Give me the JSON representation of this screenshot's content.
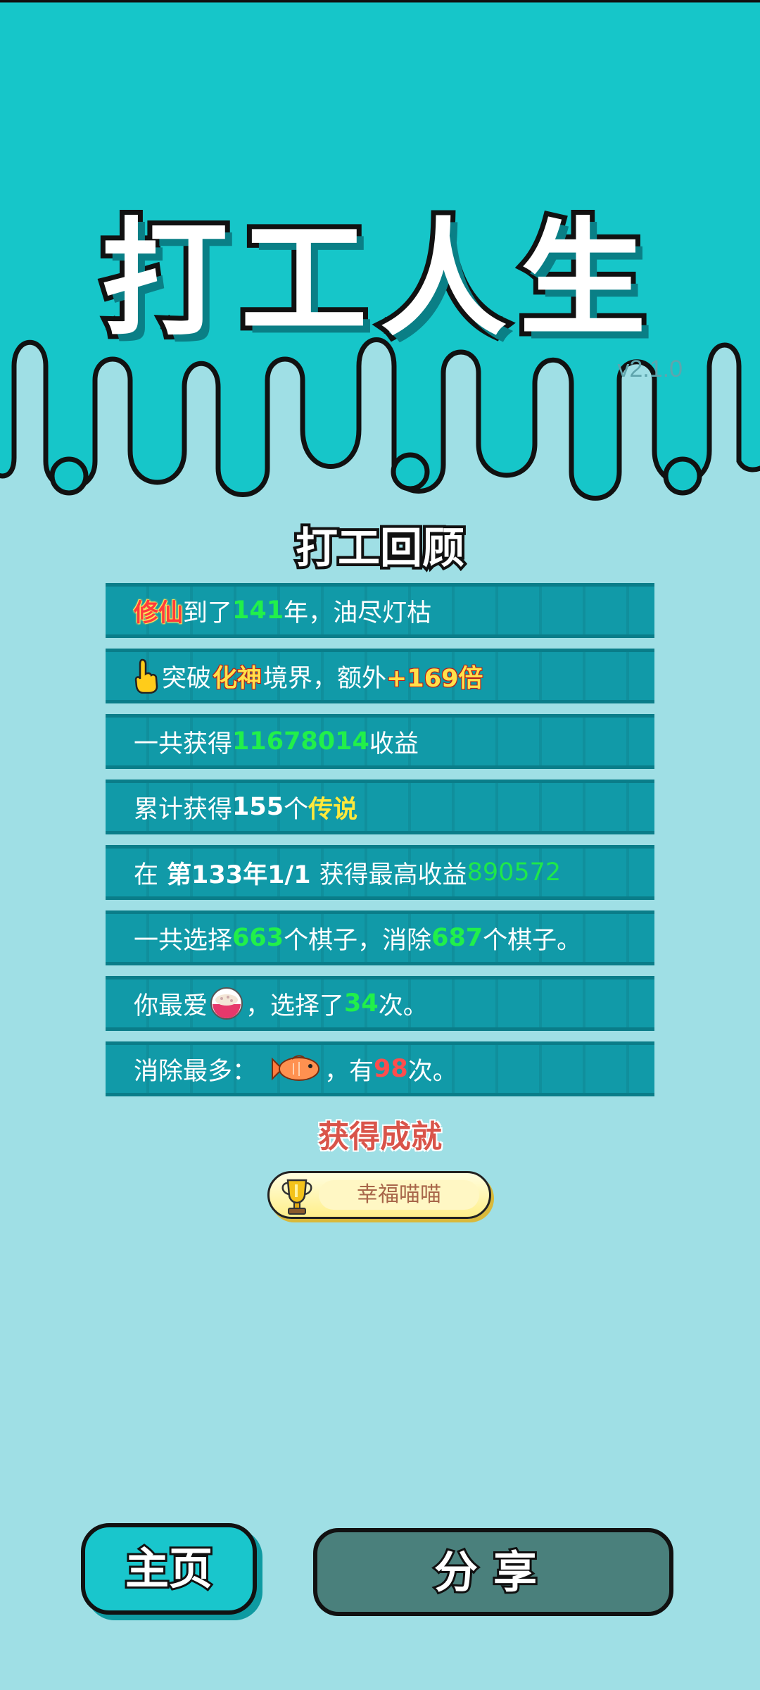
{
  "app": {
    "title": "打工人生",
    "version": "v2.1.0"
  },
  "colors": {
    "top_band": "#16c6c9",
    "body": "#9fdfe5",
    "row": "#119aa8",
    "green": "#21f04a",
    "share_button": "#4a807c"
  },
  "review": {
    "title": "打工回顾",
    "r1": {
      "a": "修仙",
      "b": "到了",
      "c": "141",
      "d": "年，油尽灯枯"
    },
    "r2": {
      "icon": "pointing-hand-icon",
      "a": "突破",
      "b": "化神",
      "c": "境界，额外",
      "d": "+169倍"
    },
    "r3": {
      "a": "一共获得",
      "b": "11678014",
      "c": "收益"
    },
    "r4": {
      "a": "累计获得",
      "b": "155",
      "c": "个",
      "d": "传说"
    },
    "r5": {
      "a": "在 ",
      "b": "第133年1/1",
      "c": " 获得最高收益",
      "d": "890572"
    },
    "r6": {
      "a": "一共选择",
      "b": "663",
      "c": "个棋子，消除",
      "d": "687",
      "e": "个棋子。"
    },
    "r7": {
      "a": "你最爱",
      "icon": "rice-bowl-icon",
      "b": "，选择了",
      "c": "34",
      "d": "次。"
    },
    "r8": {
      "a": "消除最多：",
      "icon": "fish-icon",
      "b": "，有",
      "c": "98",
      "d": "次。"
    }
  },
  "achievements": {
    "title": "获得成就",
    "items": [
      {
        "icon": "trophy-icon",
        "label": "幸福喵喵"
      }
    ]
  },
  "buttons": {
    "home": "主页",
    "share": "分享"
  }
}
